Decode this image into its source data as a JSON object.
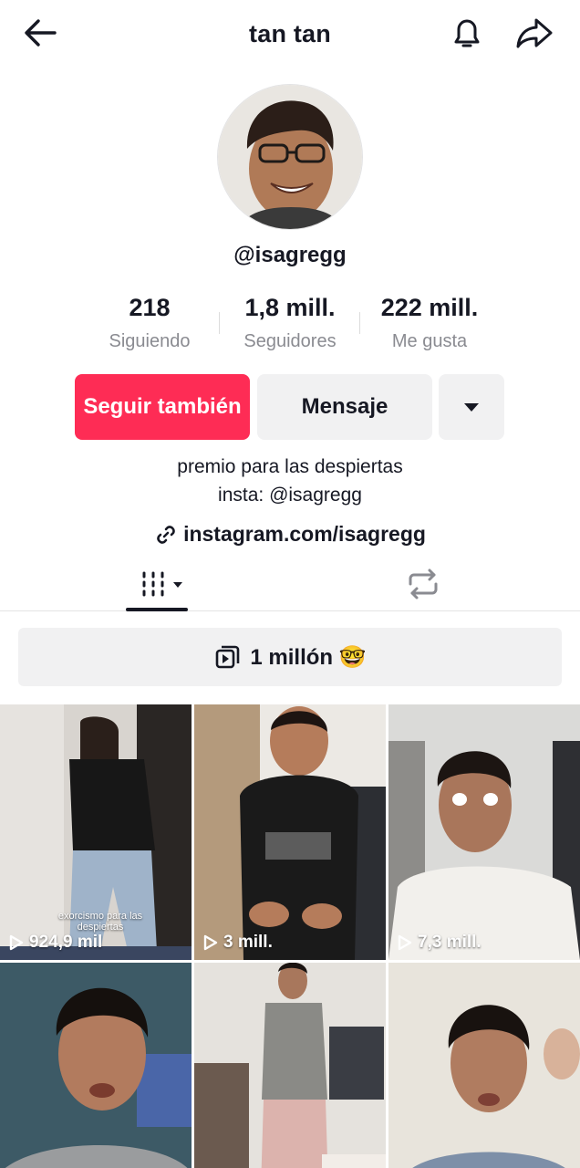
{
  "header": {
    "title": "tan tan",
    "icons": {
      "back": "arrow-left-icon",
      "notifications": "bell-icon",
      "share": "share-arrow-icon"
    }
  },
  "profile": {
    "handle": "@isagregg",
    "stats": [
      {
        "value": "218",
        "label": "Siguiendo"
      },
      {
        "value": "1,8 mill.",
        "label": "Seguidores"
      },
      {
        "value": "222 mill.",
        "label": "Me gusta"
      }
    ],
    "buttons": {
      "follow": "Seguir también",
      "message": "Mensaje",
      "more_icon": "caret-down-icon"
    },
    "bio": [
      "premio para las despiertas",
      "insta: @isagregg"
    ],
    "link": "instagram.com/isagregg"
  },
  "tabs": {
    "videos_icon": "grid-icon",
    "reposts_icon": "repost-icon"
  },
  "playlist": {
    "label": "1 millón 🤓",
    "icon": "playlist-icon"
  },
  "videos": [
    {
      "views": "924,9 mil",
      "caption": "exorcismo para las despiertas"
    },
    {
      "views": "3 mill."
    },
    {
      "views": "7,3 mill."
    },
    {
      "views": ""
    },
    {
      "views": ""
    },
    {
      "views": ""
    }
  ],
  "colors": {
    "accent": "#fe2c55",
    "button_gray": "#f1f1f2",
    "text_primary": "#161823",
    "text_secondary": "#8a8b91"
  }
}
